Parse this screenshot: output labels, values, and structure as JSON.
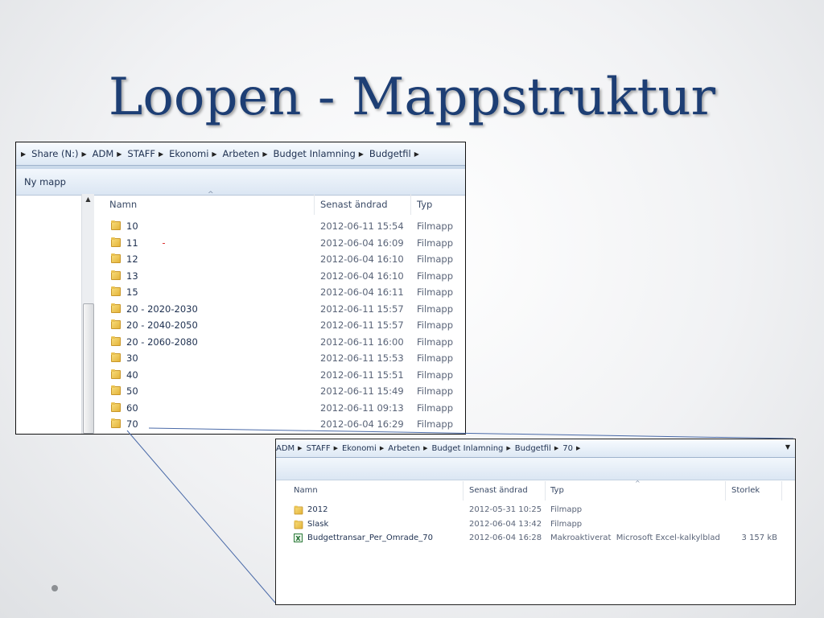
{
  "slide": {
    "title": "Loopen - Mappstruktur"
  },
  "window1": {
    "breadcrumb": [
      "Share (N:)",
      "ADM",
      "STAFF",
      "Ekonomi",
      "Arbeten",
      "Budget Inlamning",
      "Budgetfil"
    ],
    "toolbar_button": "Ny mapp",
    "columns": {
      "name": "Namn",
      "modified": "Senast ändrad",
      "type": "Typ"
    },
    "rows": [
      {
        "name": "10",
        "modified": "2012-06-11 15:54",
        "type": "Filmapp"
      },
      {
        "name": "11",
        "modified": "2012-06-04 16:09",
        "type": "Filmapp"
      },
      {
        "name": "12",
        "modified": "2012-06-04 16:10",
        "type": "Filmapp"
      },
      {
        "name": "13",
        "modified": "2012-06-04 16:10",
        "type": "Filmapp"
      },
      {
        "name": "15",
        "modified": "2012-06-04 16:11",
        "type": "Filmapp"
      },
      {
        "name": "20 - 2020-2030",
        "modified": "2012-06-11 15:57",
        "type": "Filmapp"
      },
      {
        "name": "20 - 2040-2050",
        "modified": "2012-06-11 15:57",
        "type": "Filmapp"
      },
      {
        "name": "20 - 2060-2080",
        "modified": "2012-06-11 16:00",
        "type": "Filmapp"
      },
      {
        "name": "30",
        "modified": "2012-06-11 15:53",
        "type": "Filmapp"
      },
      {
        "name": "40",
        "modified": "2012-06-11 15:51",
        "type": "Filmapp"
      },
      {
        "name": "50",
        "modified": "2012-06-11 15:49",
        "type": "Filmapp"
      },
      {
        "name": "60",
        "modified": "2012-06-11 09:13",
        "type": "Filmapp"
      },
      {
        "name": "70",
        "modified": "2012-06-04 16:29",
        "type": "Filmapp"
      }
    ]
  },
  "window2": {
    "breadcrumb": [
      "ADM",
      "STAFF",
      "Ekonomi",
      "Arbeten",
      "Budget Inlamning",
      "Budgetfil",
      "70"
    ],
    "columns": {
      "name": "Namn",
      "modified": "Senast ändrad",
      "type": "Typ",
      "size": "Storlek"
    },
    "rows": [
      {
        "icon": "folder-icon",
        "name": "2012",
        "modified": "2012-05-31 10:25",
        "type": "Filmapp",
        "size": ""
      },
      {
        "icon": "folder-icon",
        "name": "Slask",
        "modified": "2012-06-04 13:42",
        "type": "Filmapp",
        "size": ""
      },
      {
        "icon": "excel-file-icon",
        "name": "Budgettransar_Per_Omrade_70",
        "modified": "2012-06-04 16:28",
        "type": "Makroaktiverat  Microsoft Excel-kalkylblad",
        "size": "3 157 kB"
      }
    ]
  }
}
